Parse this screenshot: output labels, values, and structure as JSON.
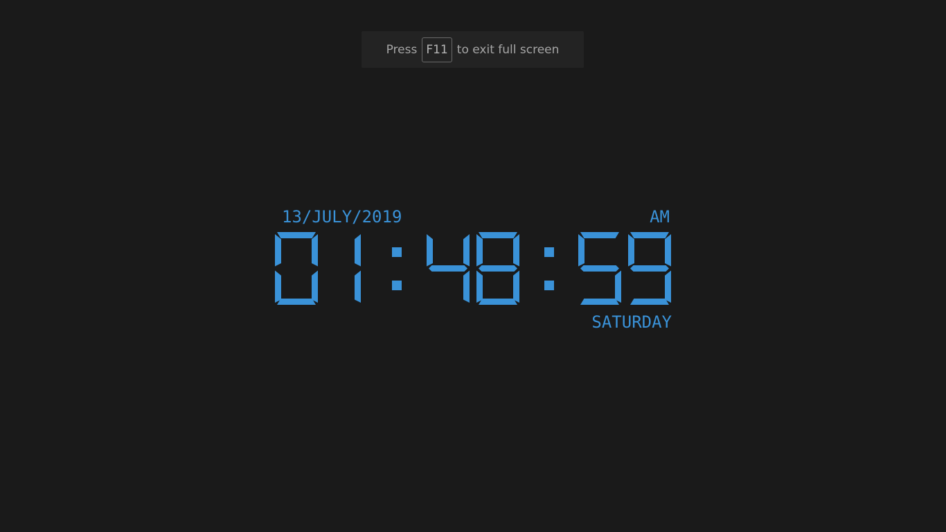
{
  "fullscreen_notice": {
    "prefix": "Press",
    "key": "F11",
    "suffix": "to exit full screen"
  },
  "clock": {
    "date": "13/JULY/2019",
    "meridiem": "AM",
    "time": "01:48:59",
    "weekday": "SATURDAY",
    "digit_color": "#3a92d8",
    "background_color": "#1a1a1a"
  }
}
